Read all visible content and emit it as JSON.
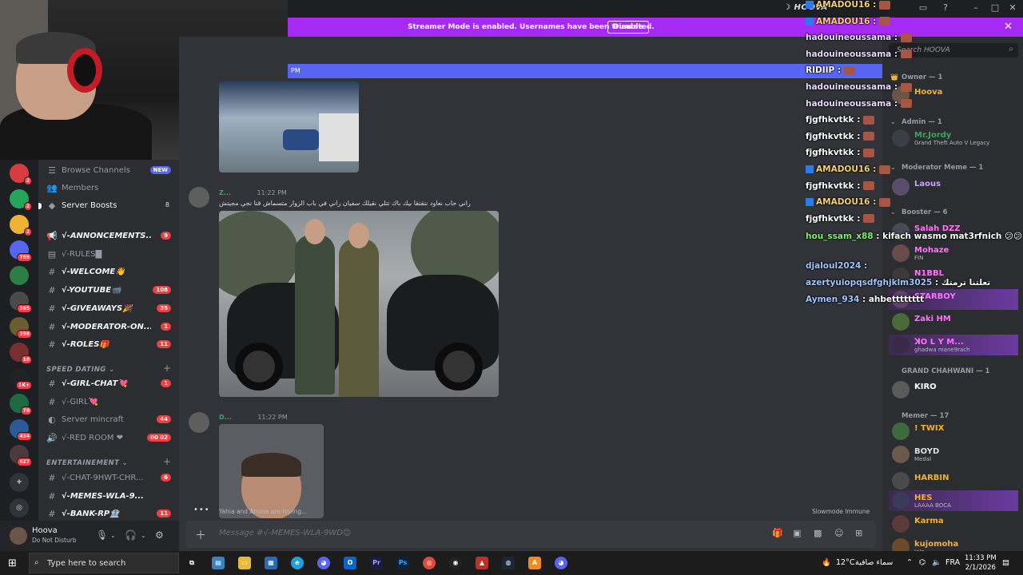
{
  "window": {
    "title": "HOOVA"
  },
  "banner": {
    "text": "Streamer Mode is enabled. Usernames have been truncated.",
    "button": "Disable"
  },
  "pinned": {
    "text": "PM"
  },
  "rail": [
    {
      "badge": "2",
      "color": "#d83c3e"
    },
    {
      "badge": "2",
      "color": "#23a55a"
    },
    {
      "badge": "2",
      "color": "#f0b232"
    },
    {
      "badge": "789",
      "color": "#5865f2"
    },
    {
      "badge": "",
      "color": "#2d7d46"
    },
    {
      "badge": "365",
      "color": "#4a4a4a"
    },
    {
      "badge": "398",
      "color": "#6a5d2e"
    },
    {
      "badge": "10",
      "color": "#7a2e2e"
    },
    {
      "badge": "1K+",
      "color": "#222"
    },
    {
      "badge": "70",
      "color": "#1d6b3e"
    },
    {
      "badge": "434",
      "color": "#2a5a9a"
    },
    {
      "badge": "627",
      "color": "#4a3a3a"
    }
  ],
  "channels": {
    "browse": {
      "label": "Browse Channels",
      "badge": "NEW"
    },
    "members": {
      "label": "Members"
    },
    "boosts": {
      "label": "Server Boosts",
      "count": "8"
    },
    "list": [
      {
        "icon": "📢",
        "label": "√-ANNONCEMENTS...",
        "count": "9",
        "bold": true
      },
      {
        "icon": "▤",
        "label": "√-RULES█",
        "count": "",
        "bold": false
      },
      {
        "icon": "#",
        "label": "√-WELCOME👋",
        "count": "",
        "bold": true
      },
      {
        "icon": "#",
        "label": "√-YOUTUBE📹",
        "count": "108",
        "bold": true
      },
      {
        "icon": "#",
        "label": "√-GIVEAWAYS🎉",
        "count": "35",
        "bold": true
      },
      {
        "icon": "#",
        "label": "√-MODERATOR-ON...",
        "count": "1",
        "bold": true
      },
      {
        "icon": "#",
        "label": "√-ROLES🎁",
        "count": "11",
        "bold": true
      }
    ],
    "cat1": "SPEED DATING ⌄",
    "list2": [
      {
        "icon": "#",
        "label": "√-GIRL-CHAT💘",
        "count": "1",
        "bold": true
      },
      {
        "icon": "#",
        "label": "√-GIRL💘",
        "count": "",
        "bold": false
      },
      {
        "icon": "◐",
        "label": "Server mincraft",
        "count": "44",
        "bold": false
      },
      {
        "icon": "🔊",
        "label": "√-RED ROOM ❤",
        "count": "00 02",
        "bold": false
      }
    ],
    "cat2": "ENTERTAINEMENT ⌄",
    "list3": [
      {
        "icon": "#",
        "label": "√-CHAT-9HWT-CHR...",
        "count": "6",
        "bold": false
      },
      {
        "icon": "#",
        "label": "√-MEMES-WLA-9...",
        "count": "",
        "bold": true
      },
      {
        "icon": "#",
        "label": "√-BANK-RP🏦",
        "count": "11",
        "bold": true
      }
    ]
  },
  "user": {
    "name": "Hoova",
    "status": "Do Not Disturb"
  },
  "messages": [
    {
      "author": "Z...",
      "time": "11:22 PM",
      "text": "راني حاب نعاود نتقتقا بيك باك تتلي نقيلك سفيان راني في باب الزوار متسماش قتا نجي مجيتش"
    },
    {
      "author": "D...",
      "time": "11:22 PM",
      "text": ""
    }
  ],
  "typing": {
    "users": "Yahia and Amine are typing...",
    "slowmode": "Slowmode Immune"
  },
  "composer": {
    "placeholder": "Message #√-MEMES-WLA-9WD😊"
  },
  "overlay": [
    {
      "name": "AMADOU16 :",
      "color": "#f4d06f",
      "tw": true
    },
    {
      "name": "AMADOU16 :",
      "color": "#f4d06f",
      "tw": true
    },
    {
      "name": "hadouineoussama :",
      "color": "#e8d8ff",
      "tw": false
    },
    {
      "name": "hadouineoussama :",
      "color": "#e8d8ff",
      "tw": false
    },
    {
      "name": "RIDIIP :",
      "color": "#fff",
      "tw": false
    },
    {
      "name": "hadouineoussama :",
      "color": "#e8d8ff",
      "tw": false
    },
    {
      "name": "hadouineoussama :",
      "color": "#e8d8ff",
      "tw": false
    },
    {
      "name": "fjgfhkvtkk :",
      "color": "#fff",
      "tw": false
    },
    {
      "name": "fjgfhkvtkk :",
      "color": "#fff",
      "tw": false
    },
    {
      "name": "fjgfhkvtkk :",
      "color": "#fff",
      "tw": false
    },
    {
      "name": "AMADOU16 :",
      "color": "#f4d06f",
      "tw": true
    },
    {
      "name": "fjgfhkvtkk :",
      "color": "#fff",
      "tw": false
    },
    {
      "name": "AMADOU16 :",
      "color": "#f4d06f",
      "tw": true
    },
    {
      "name": "fjgfhkvtkk :",
      "color": "#fff",
      "tw": false
    }
  ],
  "overlay2": [
    {
      "name": "hou_ssam_x88",
      "msg": ": kifach wasmo mat3rfnich 😕😕",
      "color": "#7cf16a"
    },
    {
      "name": "djaloul2024 :",
      "msg": "",
      "color": "#a0c4ff"
    },
    {
      "name": "azertyuiopqsdfghjklm3025",
      "msg": ": تعلتنا ترمتك",
      "color": "#a0c4ff"
    },
    {
      "name": "Aymen_934",
      "msg": ": ahbetttttttt",
      "color": "#a0c4ff"
    }
  ],
  "members": {
    "search": "Search HOOVA",
    "groups": [
      {
        "label": "Owner — 1",
        "icon": "👑"
      },
      {
        "label": "Admin — 1",
        "icon": "⌄"
      },
      {
        "label": "Moderator Meme — 1",
        "icon": "⌄"
      },
      {
        "label": "Booster — 6",
        "icon": "⌄"
      },
      {
        "label": "GRAND CHAHWANI — 1",
        "icon": ""
      },
      {
        "label": "Memer — 17",
        "icon": ""
      }
    ],
    "list": [
      {
        "name": "Hoova",
        "sub": "",
        "color": "#f0b232",
        "hl": false
      },
      {
        "name": "Mr.Jordy",
        "sub": "Grand Theft Auto V Legacy",
        "color": "#3ba55d",
        "hl": false
      },
      {
        "name": "Laous",
        "sub": "",
        "color": "#c9a0ff",
        "hl": false
      },
      {
        "name": "Salah DZZ",
        "sub": "",
        "color": "#ff73fa",
        "hl": false
      },
      {
        "name": "Mohaze",
        "sub": "FIN",
        "color": "#ff73fa",
        "hl": false
      },
      {
        "name": "N1BBL",
        "sub": "",
        "color": "#ff73fa",
        "hl": false
      },
      {
        "name": "STARBOY",
        "sub": "",
        "color": "#ff73fa",
        "hl": true
      },
      {
        "name": "Zaki HM",
        "sub": "",
        "color": "#ff73fa",
        "hl": false
      },
      {
        "name": "ꓘO L Y M...",
        "sub": "ghadwa mane9rach",
        "color": "#ff73fa",
        "hl": true
      },
      {
        "name": "KIRO",
        "sub": "",
        "color": "#fff",
        "hl": false
      },
      {
        "name": "! TWIX",
        "sub": "",
        "color": "#f0b232",
        "hl": false
      },
      {
        "name": "BOYD",
        "sub": "Medal",
        "color": "#dbdee1",
        "hl": false
      },
      {
        "name": "HARBIN",
        "sub": "",
        "color": "#f0b232",
        "hl": false
      },
      {
        "name": "HES",
        "sub": "LAAAA BOCA",
        "color": "#f0b232",
        "hl": true
      },
      {
        "name": "Karma",
        "sub": "",
        "color": "#f0b232",
        "hl": false
      },
      {
        "name": "kujomoha",
        "sub": "JoJo",
        "color": "#f0b232",
        "hl": false
      }
    ]
  },
  "taskbar": {
    "search": "Type here to search",
    "weather": "12°C",
    "weather_text": "سماء صافية",
    "lang": "FRA",
    "time": "11:33 PM",
    "date": "2/1/2026"
  }
}
